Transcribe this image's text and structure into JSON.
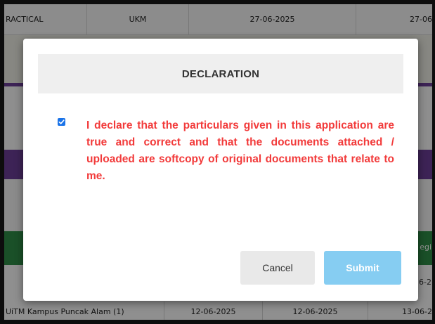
{
  "background_table": {
    "top_row": [
      "RACTICAL",
      "UKM",
      "27-06-2025",
      "27-06"
    ],
    "bottom_row": [
      "UiTM Kampus Puncak Alam (1)",
      "12-06-2025",
      "12-06-2025",
      "13-06-2"
    ],
    "right_edge_fragments": [
      "egi",
      "6-2"
    ]
  },
  "dialog": {
    "title": "DECLARATION",
    "checkbox_checked": true,
    "declaration_text": "I declare that the particulars given in this application are true and correct and that the documents attached / uploaded are softcopy of original documents that relate to me.",
    "cancel_label": "Cancel",
    "submit_label": "Submit"
  },
  "colors": {
    "declaration_text": "#f23a3a",
    "submit_button": "#86cdf2",
    "checkbox": "#1a73e8",
    "purple_band": "#6a3d94",
    "green_band": "#2e8b45"
  }
}
